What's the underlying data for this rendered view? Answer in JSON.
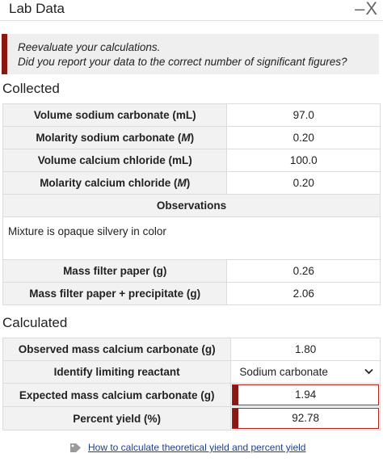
{
  "window": {
    "title": "Lab Data",
    "controls": "–X"
  },
  "alert": {
    "line1": "Reevaluate your calculations.",
    "line2": "Did you report your data to the correct number of significant figures?"
  },
  "collected": {
    "heading": "Collected",
    "rows": [
      {
        "label": "Volume sodium carbonate (mL)",
        "value": "97.0"
      },
      {
        "label_pre": "Molarity sodium carbonate (",
        "label_unit": "M",
        "label_post": ")",
        "value": "0.20"
      },
      {
        "label": "Volume calcium chloride (mL)",
        "value": "100.0"
      },
      {
        "label_pre": "Molarity calcium chloride (",
        "label_unit": "M",
        "label_post": ")",
        "value": "0.20"
      }
    ],
    "observations_heading": "Observations",
    "observations_text": "Mixture is opaque silvery in color",
    "rows2": [
      {
        "label": "Mass filter paper (g)",
        "value": "0.26"
      },
      {
        "label": "Mass filter paper + precipitate (g)",
        "value": "2.06"
      }
    ]
  },
  "calculated": {
    "heading": "Calculated",
    "rows": [
      {
        "label": "Observed mass calcium carbonate (g)",
        "value": "1.80"
      },
      {
        "label": "Identify limiting reactant",
        "value": "Sodium carbonate"
      },
      {
        "label": "Expected mass calcium carbonate (g)",
        "value": "1.94"
      },
      {
        "label": "Percent yield (%)",
        "value": "92.78"
      }
    ]
  },
  "help_link": "How to calculate theoretical yield and percent yield",
  "colors": {
    "accent": "#8a1712",
    "error_border": "#b3211a",
    "link": "#1f3f8a"
  },
  "icons": {
    "help": "tag-icon",
    "dropdown": "chevron-down-icon"
  }
}
